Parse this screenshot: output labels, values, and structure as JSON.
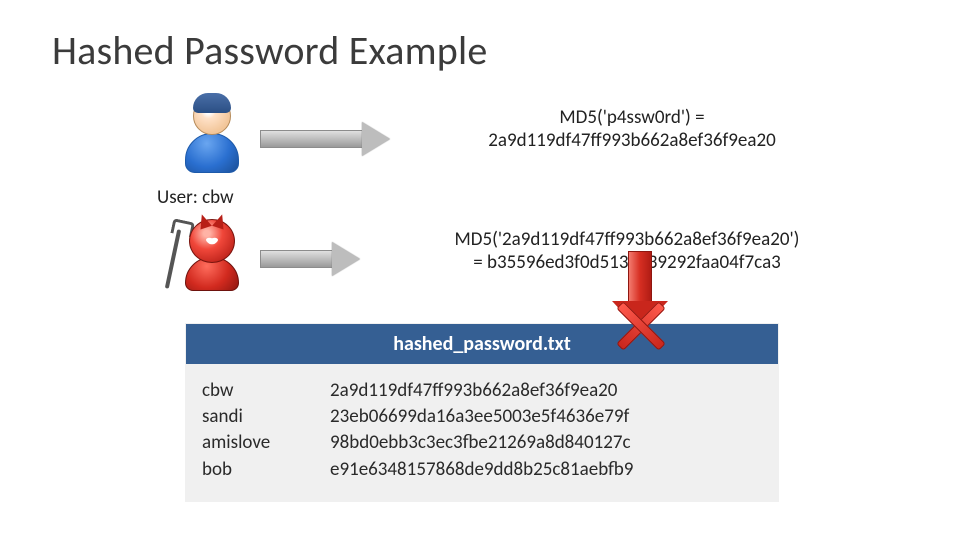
{
  "title": "Hashed Password Example",
  "user_label": "User: cbw",
  "md5_first": {
    "line1": "MD5('p4ssw0rd') =",
    "line2": "2a9d119df47ff993b662a8ef36f9ea20"
  },
  "md5_second": {
    "line1": "MD5('2a9d119df47ff993b662a8ef36f9ea20')",
    "line2": "= b35596ed3f0d5134739292faa04f7ca3"
  },
  "table": {
    "header": "hashed_password.txt",
    "rows": [
      {
        "user": "cbw",
        "hash": "2a9d119df47ff993b662a8ef36f9ea20"
      },
      {
        "user": "sandi",
        "hash": "23eb06699da16a3ee5003e5f4636e79f"
      },
      {
        "user": "amislove",
        "hash": "98bd0ebb3c3ec3fbe21269a8d840127c"
      },
      {
        "user": "bob",
        "hash": "e91e6348157868de9dd8b25c81aebfb9"
      }
    ]
  },
  "icons": {
    "user": "user-avatar-icon",
    "attacker": "devil-attacker-icon",
    "arrow_right": "arrow-right-icon",
    "arrow_down": "arrow-down-icon",
    "rejected": "red-x-icon"
  }
}
